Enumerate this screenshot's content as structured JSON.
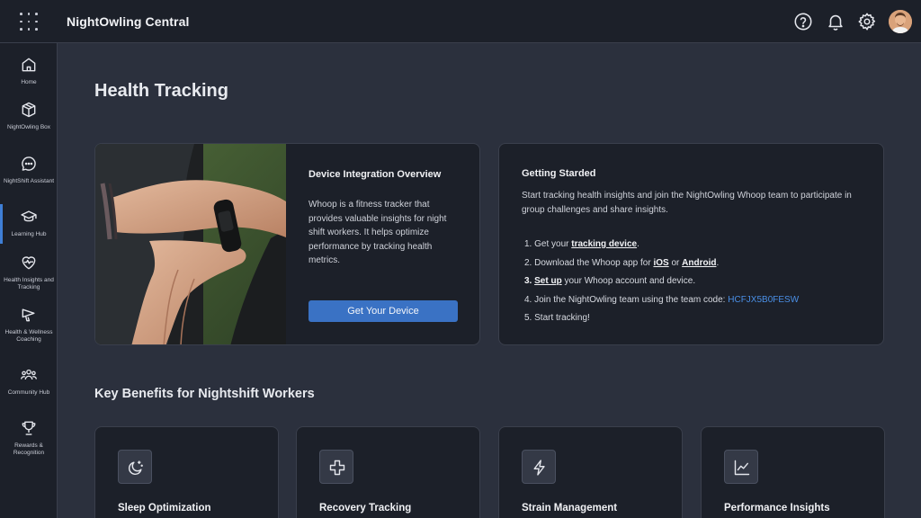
{
  "app": {
    "title": "NightOwling Central"
  },
  "header_icons": [
    "help-icon",
    "bell-icon",
    "gear-icon",
    "user-avatar"
  ],
  "sidebar": {
    "items": [
      {
        "label": "Home",
        "icon": "home-icon"
      },
      {
        "label": "NightOwling Box",
        "icon": "box-icon"
      },
      {
        "label": "NightShift Assistant",
        "icon": "chat-icon"
      },
      {
        "label": "Learning Hub",
        "icon": "graduation-cap-icon",
        "active": true
      },
      {
        "label": "Health Insights and Tracking",
        "icon": "heart-pulse-icon"
      },
      {
        "label": "Health & Wellness Coaching",
        "icon": "megaphone-icon"
      },
      {
        "label": "Community Hub",
        "icon": "people-icon"
      },
      {
        "label": "Rewards & Recognition",
        "icon": "trophy-icon"
      }
    ]
  },
  "page": {
    "title": "Health Tracking"
  },
  "device_card": {
    "heading": "Device Integration Overview",
    "body": "Whoop is a fitness tracker that provides valuable insights for night shift workers. It helps optimize performance by tracking health metrics.",
    "button": "Get Your Device"
  },
  "getting_started": {
    "heading": "Getting Starded",
    "intro": "Start tracking health insights and join the NightOwling Whoop team to participate in group challenges and share insights.",
    "steps": {
      "s1_pre": "1. Get your ",
      "s1_link": "tracking device",
      "s1_post": ".",
      "s2_pre": "2. Download the Whoop app for ",
      "s2_link1": "iOS",
      "s2_mid": " or ",
      "s2_link2": "Android",
      "s2_post": ".",
      "s3_num": "3. ",
      "s3_link": "Set up",
      "s3_post": " your Whoop account and device.",
      "s4_pre": "4. Join the NightOwling team using the team code: ",
      "s4_code": "HCFJX5B0FESW",
      "s5": "5. Start tracking!"
    }
  },
  "benefits": {
    "title": "Key Benefits for Nightshift Workers",
    "items": [
      {
        "title": "Sleep Optimization",
        "icon": "moon-stars-icon"
      },
      {
        "title": "Recovery Tracking",
        "icon": "medical-cross-icon"
      },
      {
        "title": "Strain Management",
        "icon": "lightning-icon"
      },
      {
        "title": "Performance Insights",
        "icon": "line-chart-icon"
      }
    ]
  },
  "colors": {
    "accent": "#3a72c4",
    "code": "#4a8fe6",
    "background": "#2b303d",
    "card": "#1c2029"
  }
}
